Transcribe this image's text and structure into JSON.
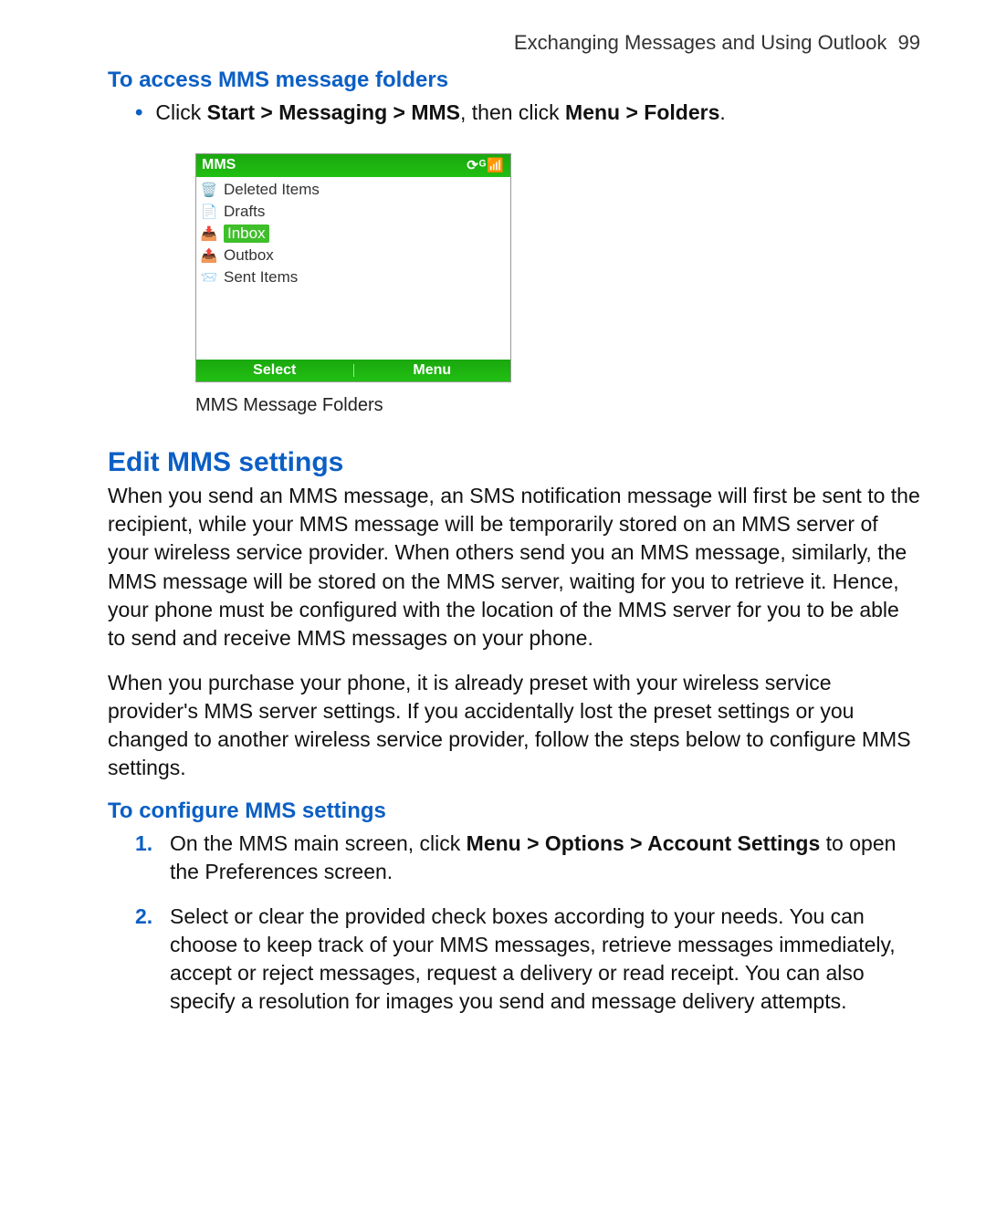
{
  "header": {
    "section": "Exchanging Messages and Using Outlook",
    "page": "99"
  },
  "access": {
    "heading": "To access MMS message folders",
    "bullet_prefix": "Click ",
    "bullet_bold1": "Start > Messaging > MMS",
    "bullet_mid": ", then click ",
    "bullet_bold2": "Menu > Folders",
    "bullet_suffix": "."
  },
  "phone": {
    "title": "MMS",
    "status": "⟳ᴳ📶",
    "folders": [
      "Deleted Items",
      "Drafts",
      "Inbox",
      "Outbox",
      "Sent Items"
    ],
    "selected_index": 2,
    "softleft": "Select",
    "softright": "Menu"
  },
  "caption": "MMS Message Folders",
  "edit": {
    "heading": "Edit MMS settings",
    "para1": "When you send an MMS message, an SMS notification message will first be sent to the recipient, while your MMS message will be temporarily stored on an MMS server of your wireless service provider. When others send you an MMS message, similarly, the MMS message will be stored on the MMS server, waiting for you to retrieve it. Hence, your phone must be configured with the location of the MMS server for you to be able to send and receive MMS messages on your phone.",
    "para2": "When you purchase your phone, it is already preset with your wireless service provider's MMS server settings. If you accidentally lost the preset settings or you changed to another wireless service provider, follow the steps below to configure MMS settings."
  },
  "configure": {
    "heading": "To configure MMS settings",
    "steps": [
      {
        "num": "1.",
        "prefix": "On the MMS main screen, click ",
        "bold": "Menu > Options > Account Settings",
        "suffix": " to open the Preferences screen."
      },
      {
        "num": "2.",
        "prefix": "",
        "bold": "",
        "suffix": "Select or clear the provided check boxes according to your needs. You can choose to keep track of your MMS messages, retrieve messages immediately, accept or reject messages, request a delivery or read receipt. You can also specify a resolution for images you send and message delivery attempts."
      }
    ]
  }
}
